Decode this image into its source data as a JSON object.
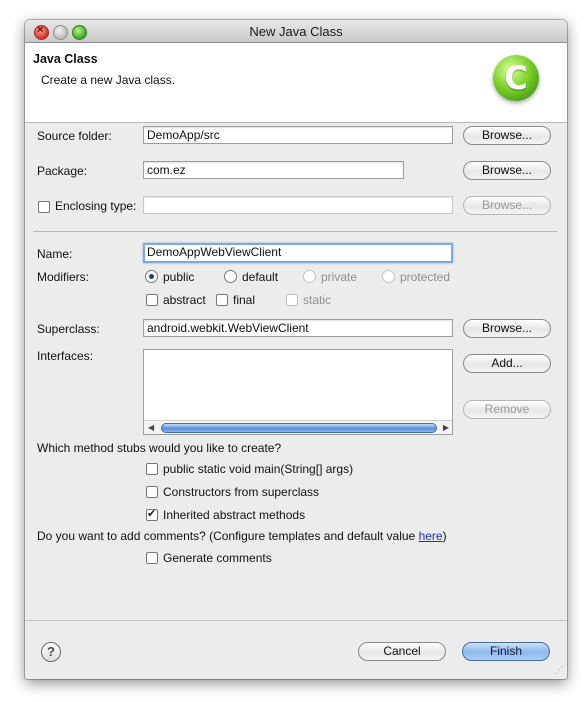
{
  "window": {
    "title": "New Java Class"
  },
  "header": {
    "title": "Java Class",
    "description": "Create a new Java class.",
    "logo_letter": "C"
  },
  "source_folder": {
    "label": "Source folder:",
    "value": "DemoApp/src",
    "browse": "Browse..."
  },
  "package": {
    "label": "Package:",
    "value": "com.ez",
    "browse": "Browse..."
  },
  "enclosing": {
    "label": "Enclosing type:",
    "checked": false,
    "value": "",
    "browse": "Browse..."
  },
  "name": {
    "label": "Name:",
    "value": "DemoAppWebViewClient"
  },
  "modifiers": {
    "label": "Modifiers:",
    "access": [
      {
        "label": "public",
        "selected": true,
        "enabled": true
      },
      {
        "label": "default",
        "selected": false,
        "enabled": true
      },
      {
        "label": "private",
        "selected": false,
        "enabled": false
      },
      {
        "label": "protected",
        "selected": false,
        "enabled": false
      }
    ],
    "flags": [
      {
        "label": "abstract",
        "checked": false,
        "enabled": true
      },
      {
        "label": "final",
        "checked": false,
        "enabled": true
      },
      {
        "label": "static",
        "checked": false,
        "enabled": false
      }
    ]
  },
  "superclass": {
    "label": "Superclass:",
    "value": "android.webkit.WebViewClient",
    "browse": "Browse..."
  },
  "interfaces": {
    "label": "Interfaces:",
    "add": "Add...",
    "remove": "Remove",
    "items": []
  },
  "stubs": {
    "question": "Which method stubs would you like to create?",
    "options": [
      {
        "label": "public static void main(String[] args)",
        "checked": false
      },
      {
        "label": "Constructors from superclass",
        "checked": false
      },
      {
        "label": "Inherited abstract methods",
        "checked": true
      }
    ]
  },
  "comments": {
    "question_prefix": "Do you want to add comments? (Configure templates and default value ",
    "link": "here",
    "question_suffix": ")",
    "option": {
      "label": "Generate comments",
      "checked": false
    }
  },
  "footer": {
    "help": "?",
    "cancel": "Cancel",
    "finish": "Finish"
  }
}
